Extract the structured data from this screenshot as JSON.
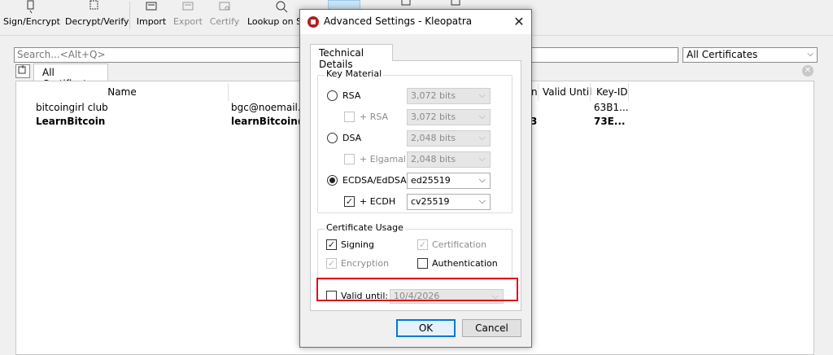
{
  "toolbar": {
    "sign_encrypt": "Sign/Encrypt",
    "decrypt_verify": "Decrypt/Verify",
    "import": "Import",
    "export": "Export",
    "certify": "Certify",
    "lookup": "Lookup on Se"
  },
  "search": {
    "placeholder": "Search...<Alt+Q>"
  },
  "filter": {
    "selected": "All Certificates",
    "arrow": "⌵"
  },
  "list_tab": {
    "label": "All Certificates",
    "close": "✕"
  },
  "columns": {
    "name": "Name",
    "email": "",
    "valid_from_partial": "n",
    "valid_until": "Valid Until",
    "key_id": "Key-ID"
  },
  "rows": [
    {
      "name": "bitcoingirl club",
      "email": "bgc@noemail.co",
      "valid_partial": "",
      "key_id": "63B1..."
    },
    {
      "name": "LearnBitcoin",
      "email": "learnBitcoin@d",
      "valid_partial": "3",
      "key_id": "73E..."
    }
  ],
  "dialog": {
    "title": "Advanced Settings - Kleopatra",
    "close": "✕",
    "tab": "Technical Details",
    "key_material": {
      "title": "Key Material",
      "rsa": {
        "label": "RSA",
        "value": "3,072 bits",
        "selected": false
      },
      "plus_rsa": {
        "label": "+ RSA",
        "value": "3,072 bits",
        "checked": false
      },
      "dsa": {
        "label": "DSA",
        "value": "2,048 bits",
        "selected": false
      },
      "plus_elgamal": {
        "label": "+ Elgamal",
        "value": "2,048 bits",
        "checked": false
      },
      "ecdsa": {
        "label": "ECDSA/EdDSA",
        "value": "ed25519",
        "selected": true
      },
      "plus_ecdh": {
        "label": "+ ECDH",
        "value": "cv25519",
        "checked": true
      }
    },
    "cert_usage": {
      "title": "Certificate Usage",
      "signing": {
        "label": "Signing",
        "checked": true
      },
      "certification": {
        "label": "Certification",
        "checked": true
      },
      "encryption": {
        "label": "Encryption",
        "checked": true
      },
      "authentication": {
        "label": "Authentication",
        "checked": false
      }
    },
    "valid_until": {
      "label": "Valid until:",
      "value": "10/4/2026",
      "checked": false
    },
    "ok": "OK",
    "cancel": "Cancel"
  },
  "colors": {
    "highlight": "#e0101a",
    "default_button": "#0078d7",
    "app_icon": "#b21f1f"
  },
  "glyphs": {
    "check": "✓",
    "combo_arrow": "⌵"
  }
}
